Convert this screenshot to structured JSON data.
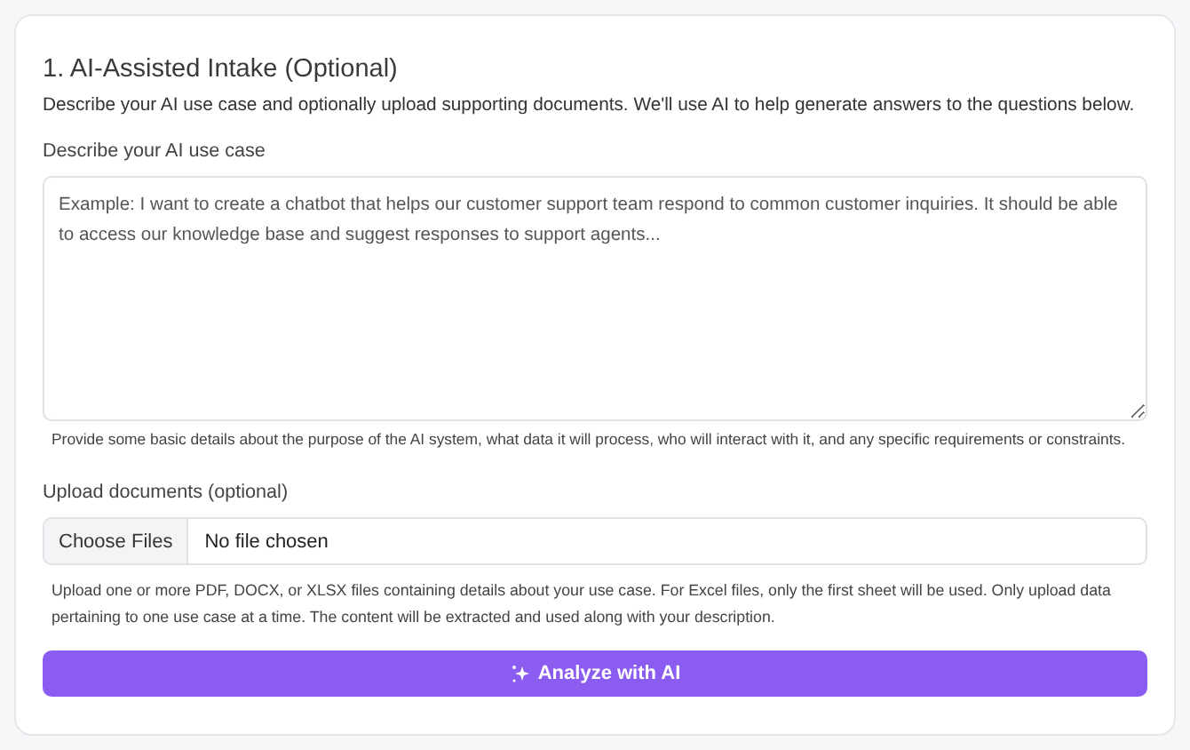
{
  "section": {
    "title": "1. AI-Assisted Intake (Optional)",
    "description": "Describe your AI use case and optionally upload supporting documents. We'll use AI to help generate answers to the questions below."
  },
  "use_case": {
    "label": "Describe your AI use case",
    "placeholder": "Example: I want to create a chatbot that helps our customer support team respond to common customer inquiries. It should be able to access our knowledge base and suggest responses to support agents...",
    "hint": "Provide some basic details about the purpose of the AI system, what data it will process, who will interact with it, and any specific requirements or constraints."
  },
  "upload": {
    "label": "Upload documents (optional)",
    "button": "Choose Files",
    "status": "No file chosen",
    "hint": "Upload one or more PDF, DOCX, or XLSX files containing details about your use case. For Excel files, only the first sheet will be used. Only upload data pertaining to one use case at a time. The content will be extracted and used along with your description."
  },
  "analyze_button": {
    "label": "Analyze with AI"
  }
}
